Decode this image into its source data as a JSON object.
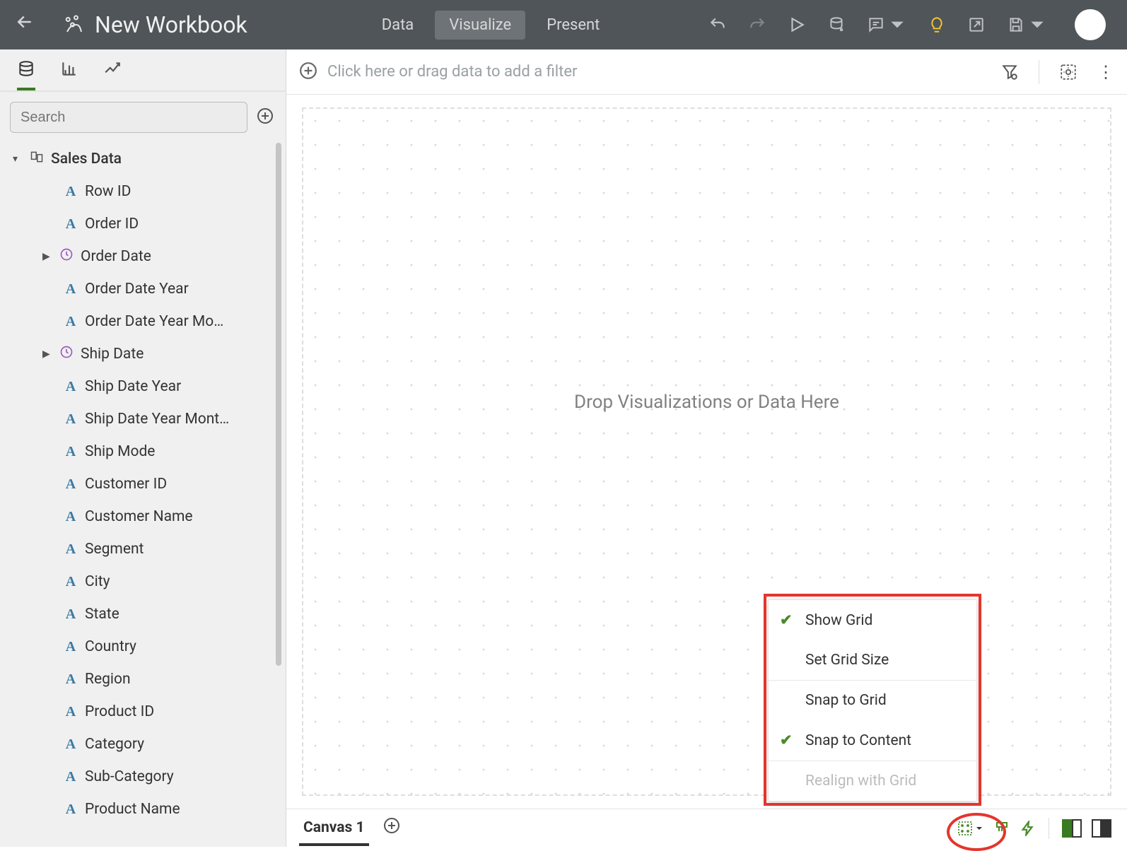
{
  "header": {
    "workbook_title": "New Workbook",
    "modes": {
      "data": "Data",
      "visualize": "Visualize",
      "present": "Present"
    }
  },
  "sidebar": {
    "search_placeholder": "Search",
    "dataset_name": "Sales Data",
    "fields": [
      {
        "label": "Row ID",
        "icon": "A"
      },
      {
        "label": "Order ID",
        "icon": "A"
      },
      {
        "label": "Order Date",
        "icon": "clock",
        "expandable": true
      },
      {
        "label": "Order Date Year",
        "icon": "A"
      },
      {
        "label": "Order Date Year Mo…",
        "icon": "A"
      },
      {
        "label": "Ship Date",
        "icon": "clock",
        "expandable": true
      },
      {
        "label": "Ship Date Year",
        "icon": "A"
      },
      {
        "label": "Ship Date Year Mont…",
        "icon": "A"
      },
      {
        "label": "Ship Mode",
        "icon": "A"
      },
      {
        "label": "Customer ID",
        "icon": "A"
      },
      {
        "label": "Customer Name",
        "icon": "A"
      },
      {
        "label": "Segment",
        "icon": "A"
      },
      {
        "label": "City",
        "icon": "A"
      },
      {
        "label": "State",
        "icon": "A"
      },
      {
        "label": "Country",
        "icon": "A"
      },
      {
        "label": "Region",
        "icon": "A"
      },
      {
        "label": "Product ID",
        "icon": "A"
      },
      {
        "label": "Category",
        "icon": "A"
      },
      {
        "label": "Sub-Category",
        "icon": "A"
      },
      {
        "label": "Product Name",
        "icon": "A"
      }
    ]
  },
  "main": {
    "filter_hint": "Click here or drag data to add a filter",
    "canvas_hint": "Drop Visualizations or Data Here",
    "grid_menu": {
      "show_grid": "Show Grid",
      "set_grid_size": "Set Grid Size",
      "snap_to_grid": "Snap to Grid",
      "snap_to_content": "Snap to Content",
      "realign": "Realign with Grid"
    }
  },
  "bottom": {
    "canvas_tab": "Canvas 1"
  }
}
